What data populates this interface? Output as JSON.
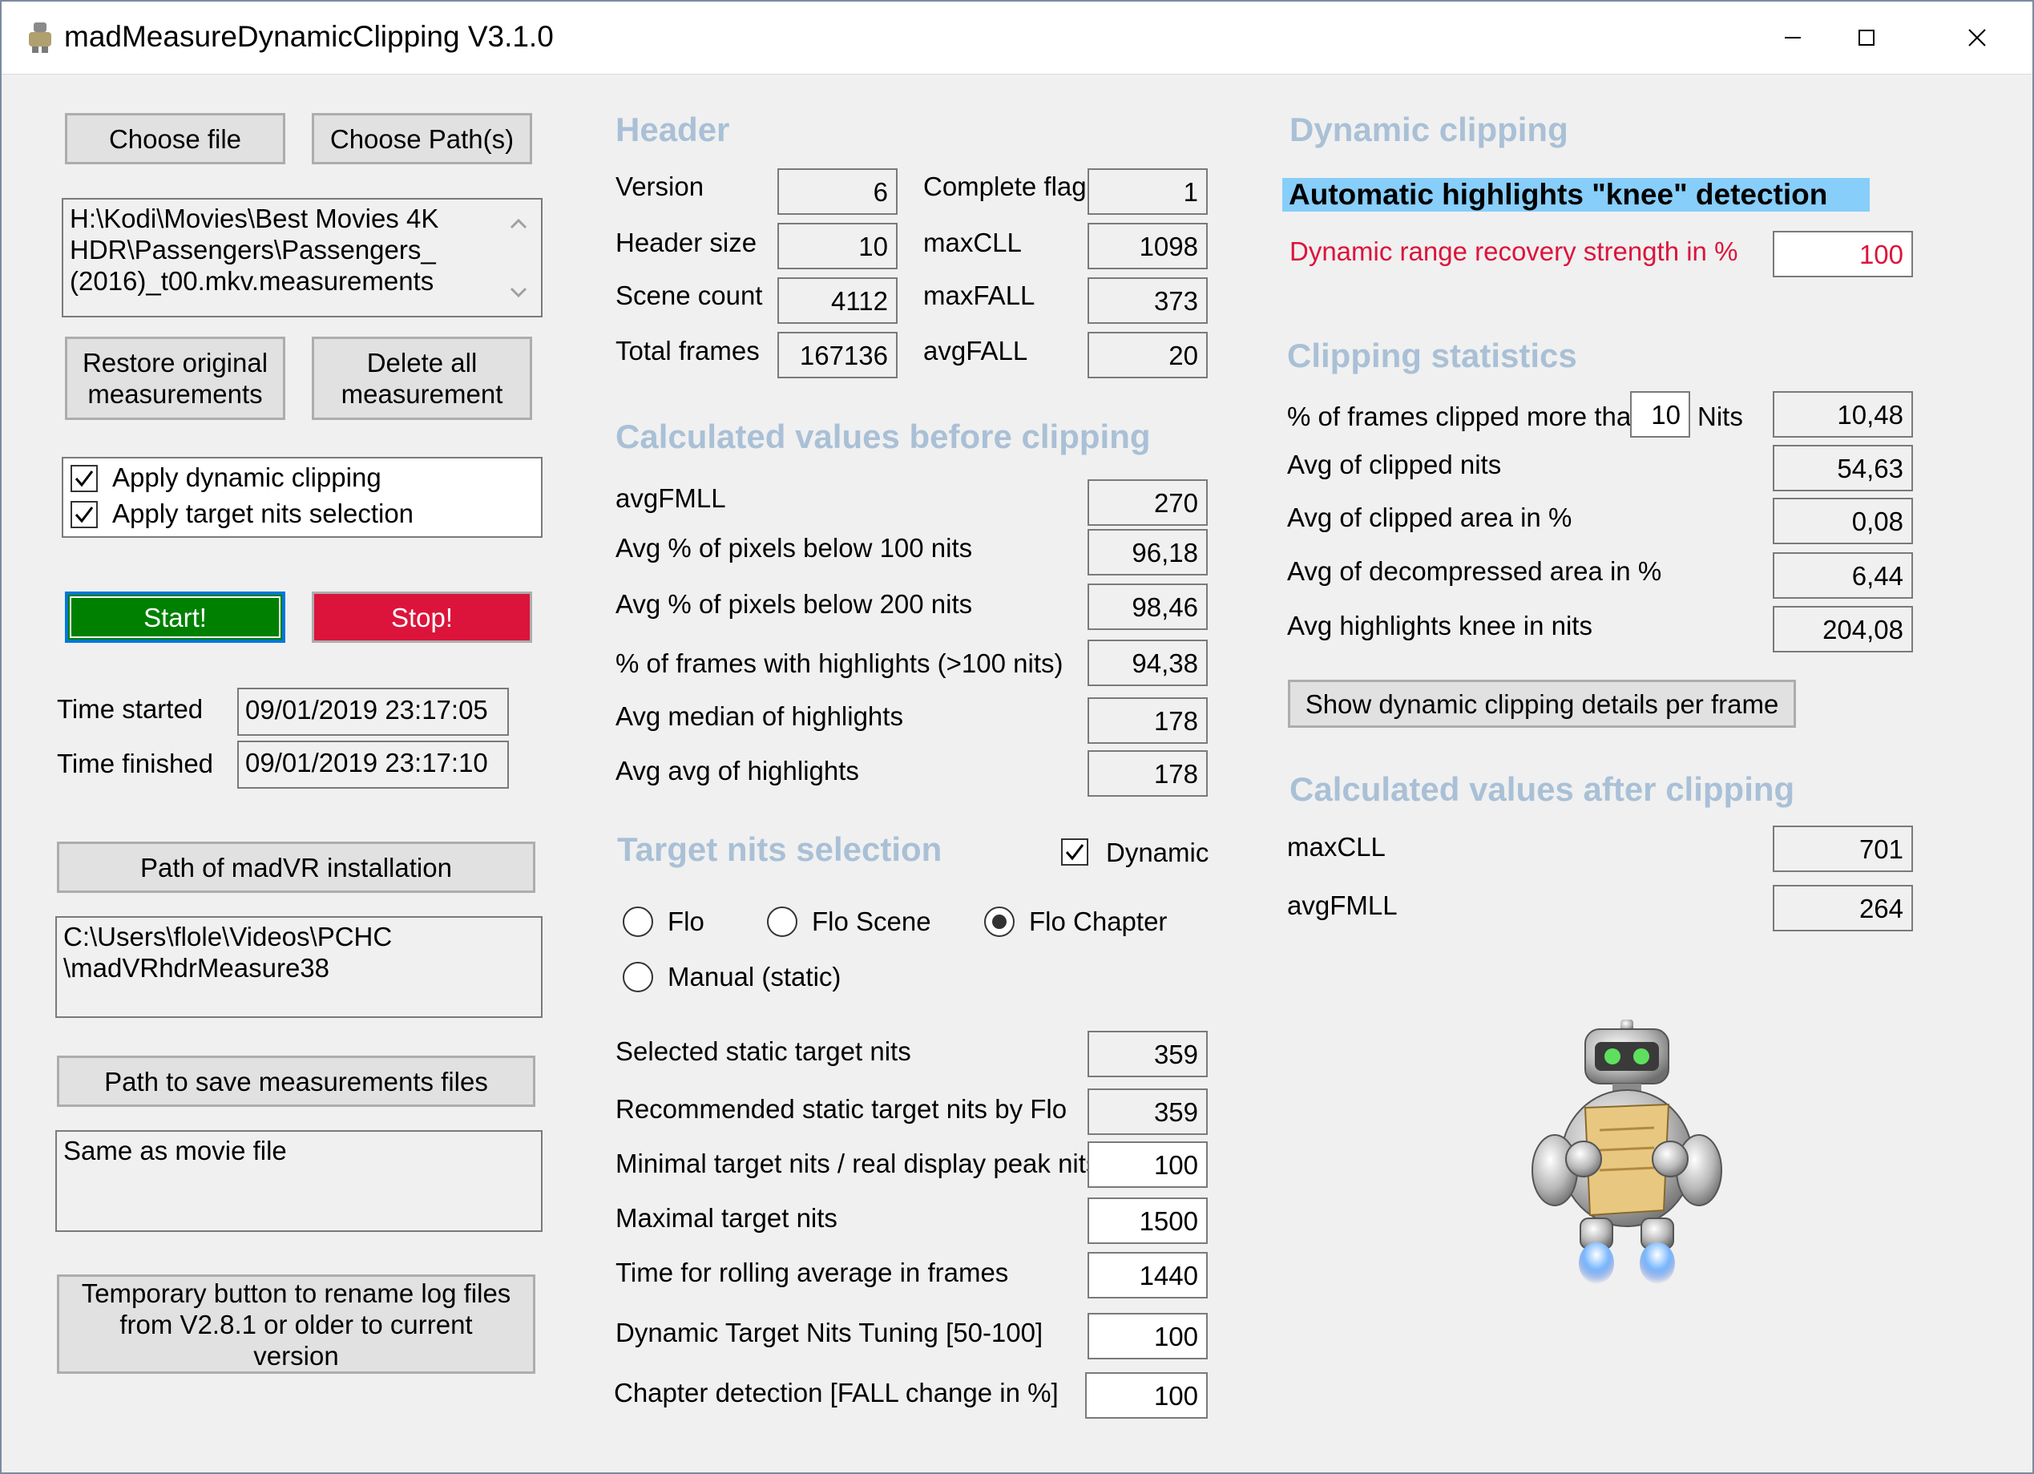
{
  "window": {
    "title": "madMeasureDynamicClipping V3.1.0"
  },
  "left": {
    "choose_file": "Choose file",
    "choose_paths": "Choose Path(s)",
    "file_path": "H:\\Kodi\\Movies\\Best Movies 4K HDR\\Passengers\\Passengers_ (2016)_t00.mkv.measurements",
    "restore_button": "Restore original measurements",
    "delete_button": "Delete all measurement",
    "apply_dynamic_clipping": "Apply dynamic clipping",
    "apply_target_nits": "Apply target nits selection",
    "start": "Start!",
    "stop": "Stop!",
    "time_started_label": "Time started",
    "time_started_value": "09/01/2019 23:17:05",
    "time_finished_label": "Time finished",
    "time_finished_value": "09/01/2019 23:17:10",
    "madvr_path_button": "Path of madVR installation",
    "madvr_path_value": "C:\\Users\\flole\\Videos\\PCHC \\madVRhdrMeasure38",
    "save_path_button": "Path to save measurements files",
    "save_path_value": "Same as movie file",
    "rename_button": "Temporary button to rename log files from V2.8.1 or older to current version"
  },
  "header": {
    "title": "Header",
    "version_label": "Version",
    "version": "6",
    "complete_flag_label": "Complete flag",
    "complete_flag": "1",
    "header_size_label": "Header size",
    "header_size": "10",
    "maxcll_label": "maxCLL",
    "maxcll": "1098",
    "scene_count_label": "Scene count",
    "scene_count": "4112",
    "maxfall_label": "maxFALL",
    "maxfall": "373",
    "total_frames_label": "Total frames",
    "total_frames": "167136",
    "avgfall_label": "avgFALL",
    "avgfall": "20"
  },
  "before": {
    "title": "Calculated values before clipping",
    "rows": [
      {
        "label": "avgFMLL",
        "value": "270"
      },
      {
        "label": "Avg % of pixels below 100 nits",
        "value": "96,18"
      },
      {
        "label": "Avg % of pixels below 200 nits",
        "value": "98,46"
      },
      {
        "label": "% of frames with highlights (>100 nits)",
        "value": "94,38"
      },
      {
        "label": "Avg median of highlights",
        "value": "178"
      },
      {
        "label": "Avg avg of highlights",
        "value": "178"
      }
    ]
  },
  "target": {
    "title": "Target nits selection",
    "dynamic_label": "Dynamic",
    "radio_flo": "Flo",
    "radio_flo_scene": "Flo Scene",
    "radio_flo_chapter": "Flo Chapter",
    "radio_manual": "Manual (static)",
    "rows": [
      {
        "label": "Selected static target nits",
        "value": "359"
      },
      {
        "label": "Recommended static target nits by Flo",
        "value": "359"
      },
      {
        "label": "Minimal target nits / real display peak nits",
        "value": "100"
      },
      {
        "label": "Maximal target nits",
        "value": "1500"
      },
      {
        "label": "Time for rolling average in frames",
        "value": "1440"
      },
      {
        "label": "Dynamic Target Nits Tuning [50-100]",
        "value": "100"
      },
      {
        "label": "Chapter detection [FALL change in %]",
        "value": "100"
      }
    ]
  },
  "dynamic": {
    "title": "Dynamic clipping",
    "knee_heading": "Automatic highlights \"knee\" detection",
    "recovery_label": "Dynamic range recovery strength in %",
    "recovery_value": "100"
  },
  "stats": {
    "title": "Clipping statistics",
    "frames_clipped_prefix": "% of frames clipped more than",
    "frames_clipped_threshold": "10",
    "frames_clipped_suffix": "Nits",
    "frames_clipped_value": "10,48",
    "avg_clipped_nits_label": "Avg of clipped nits",
    "avg_clipped_nits": "54,63",
    "avg_clipped_area_label": "Avg of clipped area in %",
    "avg_clipped_area": "0,08",
    "avg_decompressed_label": "Avg of decompressed area in %",
    "avg_decompressed": "6,44",
    "avg_knee_label": "Avg highlights knee in nits",
    "avg_knee": "204,08",
    "details_button": "Show dynamic clipping details per frame"
  },
  "after": {
    "title": "Calculated values after clipping",
    "maxcll_label": "maxCLL",
    "maxcll": "701",
    "avgfmll_label": "avgFMLL",
    "avgfmll": "264"
  },
  "colors": {
    "section_title": "#a9c0d6",
    "start_bg": "#008000",
    "stop_bg": "#dc143c",
    "knee_highlight": "#87cefa",
    "recovery_label": "#dc143c"
  }
}
